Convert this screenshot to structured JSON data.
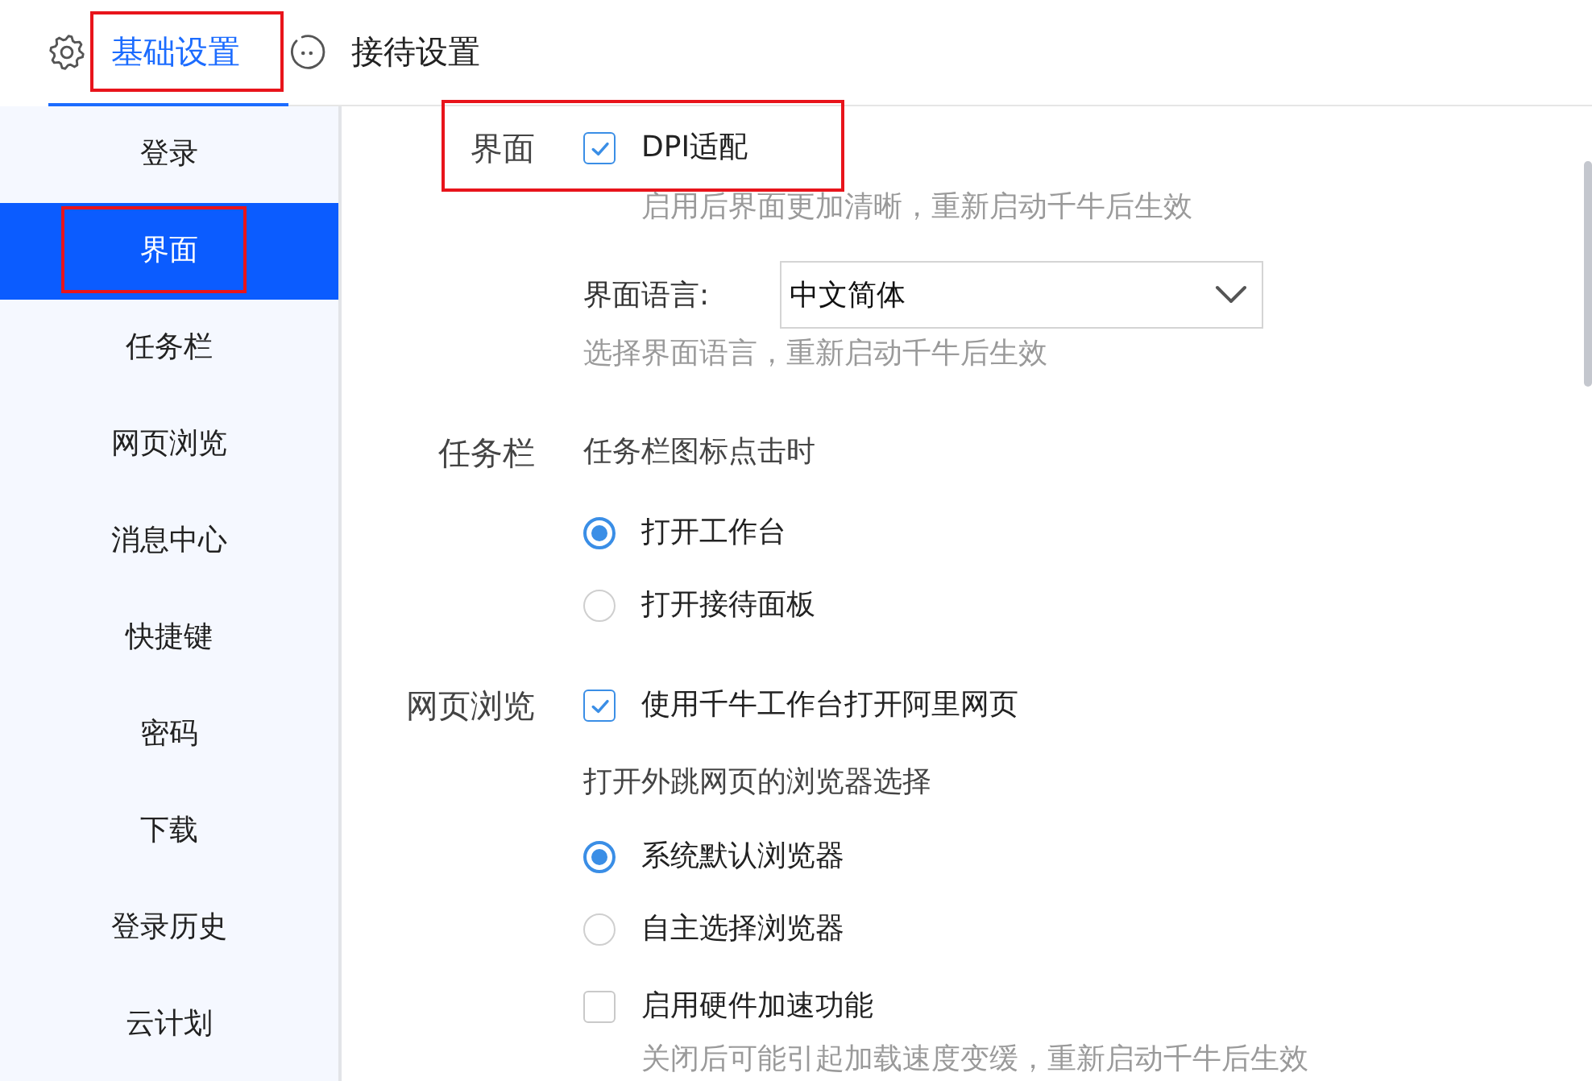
{
  "tabs": [
    {
      "label": "基础设置",
      "selected": true,
      "highlighted": true
    },
    {
      "label": "接待设置",
      "selected": false,
      "highlighted": false
    }
  ],
  "sidebar": {
    "items": [
      {
        "label": "登录",
        "selected": false,
        "highlighted": false
      },
      {
        "label": "界面",
        "selected": true,
        "highlighted": true
      },
      {
        "label": "任务栏",
        "selected": false,
        "highlighted": false
      },
      {
        "label": "网页浏览",
        "selected": false,
        "highlighted": false
      },
      {
        "label": "消息中心",
        "selected": false,
        "highlighted": false
      },
      {
        "label": "快捷键",
        "selected": false,
        "highlighted": false
      },
      {
        "label": "密码",
        "selected": false,
        "highlighted": false
      },
      {
        "label": "下载",
        "selected": false,
        "highlighted": false
      },
      {
        "label": "登录历史",
        "selected": false,
        "highlighted": false
      },
      {
        "label": "云计划",
        "selected": false,
        "highlighted": false
      }
    ]
  },
  "sections": [
    {
      "label": "界面",
      "highlighted": true,
      "items": [
        {
          "kind": "checkbox",
          "label": "DPI适配",
          "checked": true
        },
        {
          "kind": "hint",
          "text": "启用后界面更加清晰，重新启动千牛后生效"
        },
        {
          "kind": "select",
          "label": "界面语言:",
          "value": "中文简体"
        },
        {
          "kind": "hint",
          "text": "选择界面语言，重新启动千牛后生效"
        }
      ]
    },
    {
      "label": "任务栏",
      "highlighted": false,
      "items": [
        {
          "kind": "caption",
          "text": "任务栏图标点击时"
        },
        {
          "kind": "radio",
          "label": "打开工作台",
          "selected": true
        },
        {
          "kind": "radio",
          "label": "打开接待面板",
          "selected": false
        }
      ]
    },
    {
      "label": "网页浏览",
      "highlighted": false,
      "items": [
        {
          "kind": "checkbox",
          "label": "使用千牛工作台打开阿里网页",
          "checked": true
        },
        {
          "kind": "caption",
          "text": "打开外跳网页的浏览器选择"
        },
        {
          "kind": "radio",
          "label": "系统默认浏览器",
          "selected": true
        },
        {
          "kind": "radio",
          "label": "自主选择浏览器",
          "selected": false
        },
        {
          "kind": "checkbox",
          "label": "启用硬件加速功能",
          "checked": false
        },
        {
          "kind": "hint",
          "text": "关闭后可能引起加载速度变缓，重新启动千牛后生效"
        }
      ]
    }
  ]
}
